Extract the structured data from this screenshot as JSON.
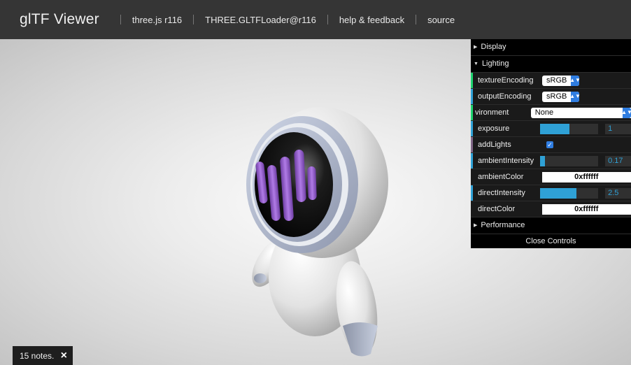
{
  "header": {
    "title": "glTF Viewer",
    "links": [
      "three.js r116",
      "THREE.GLTFLoader@r116",
      "help & feedback",
      "source"
    ]
  },
  "gui": {
    "display_label": "Display",
    "lighting_label": "Lighting",
    "performance_label": "Performance",
    "close_label": "Close Controls",
    "texture_encoding": {
      "label": "textureEncoding",
      "value": "sRGB"
    },
    "output_encoding": {
      "label": "outputEncoding",
      "value": "sRGB"
    },
    "environment": {
      "label": "vironment",
      "value": "None"
    },
    "exposure": {
      "label": "exposure",
      "value": "1",
      "fill": 0.5
    },
    "add_lights": {
      "label": "addLights",
      "checked": true
    },
    "ambient_intensity": {
      "label": "ambientIntensity",
      "value": "0.17",
      "fill": 0.085
    },
    "ambient_color": {
      "label": "ambientColor",
      "value": "0xffffff"
    },
    "direct_intensity": {
      "label": "directIntensity",
      "value": "2.5",
      "fill": 0.625
    },
    "direct_color": {
      "label": "directColor",
      "value": "0xffffff"
    }
  },
  "notes": {
    "text": "15 notes.",
    "close_icon": "×"
  },
  "colors": {
    "header_bg": "#353535",
    "accent_blue": "#2fa1d6",
    "accent_green": "#1ed36f"
  }
}
